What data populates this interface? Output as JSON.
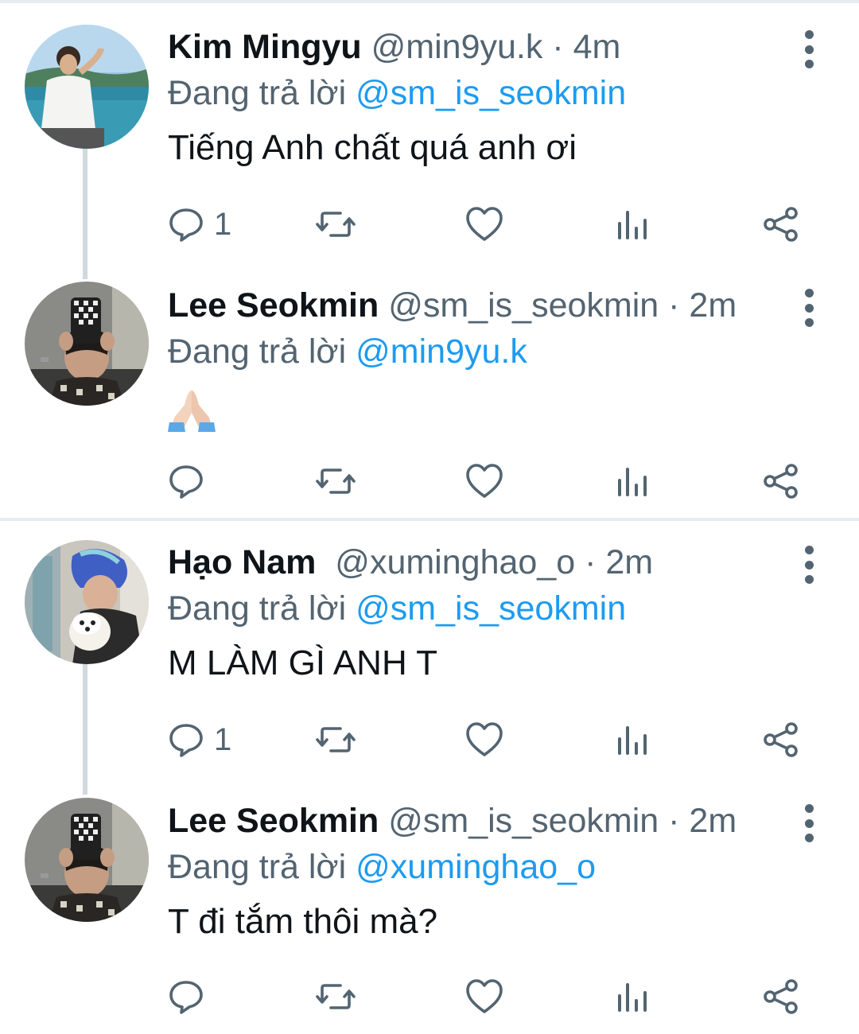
{
  "tweets": [
    {
      "name": "Kim Mingyu",
      "handle": "@min9yu.k",
      "time": "4m",
      "replying_prefix": "Đang trả lời",
      "replying_to": "@sm_is_seokmin",
      "text": "Tiếng Anh chất quá anh ơi",
      "reply_count": "1",
      "avatar": "man-by-sea-photo"
    },
    {
      "name": "Lee Seokmin",
      "handle": "@sm_is_seokmin",
      "time": "2m",
      "replying_prefix": "Đang trả lời",
      "replying_to": "@min9yu.k",
      "text": "🙏🏻",
      "reply_count": "",
      "avatar": "mirror-selfie-photo"
    },
    {
      "name": "Hạo Nam",
      "handle": "@xuminghao_o",
      "time": "2m",
      "replying_prefix": "Đang trả lời",
      "replying_to": "@sm_is_seokmin",
      "text": "M LÀM GÌ ANH T",
      "reply_count": "1",
      "avatar": "blue-hair-with-dog-photo"
    },
    {
      "name": "Lee Seokmin",
      "handle": "@sm_is_seokmin",
      "time": "2m",
      "replying_prefix": "Đang trả lời",
      "replying_to": "@xuminghao_o",
      "text": "T đi tắm thôi mà?",
      "reply_count": "",
      "avatar": "mirror-selfie-photo"
    }
  ],
  "icons": [
    "reply-icon",
    "retweet-icon",
    "like-icon",
    "views-icon",
    "share-icon",
    "more-icon"
  ],
  "colors": {
    "mention": "#1d9bf0",
    "secondary": "#536471",
    "thread_line": "#cfd9de"
  }
}
